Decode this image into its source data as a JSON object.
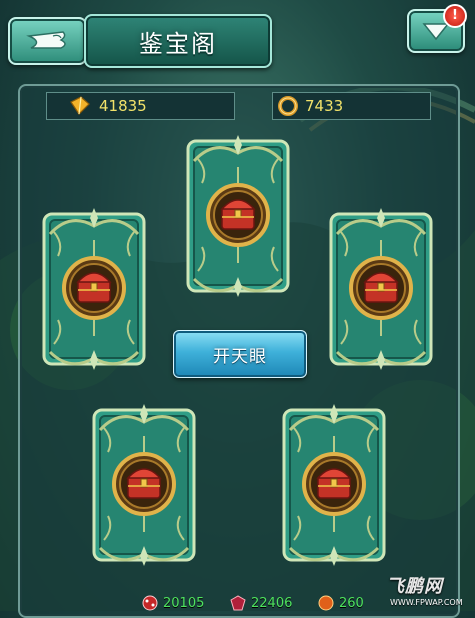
{
  "header": {
    "title": "鉴宝阁",
    "alert_count": "!"
  },
  "currency": {
    "gold": "41835",
    "jade": "7433"
  },
  "actions": {
    "open_eye_label": "开天眼"
  },
  "bottom_resources": [
    {
      "icon": "red-gem-icon",
      "value": "20105"
    },
    {
      "icon": "ruby-icon",
      "value": "22406"
    },
    {
      "icon": "orange-orb-icon",
      "value": "260"
    }
  ],
  "watermark": {
    "text": "飞鹏网",
    "url": "WWW.FPWAP.COM"
  },
  "colors": {
    "card_green": "#2f9d86",
    "card_border": "#cfe6b8",
    "ornament_gold": "#b8cc8a",
    "value_yellow": "#f1e26a",
    "value_green": "#4ee35f"
  }
}
